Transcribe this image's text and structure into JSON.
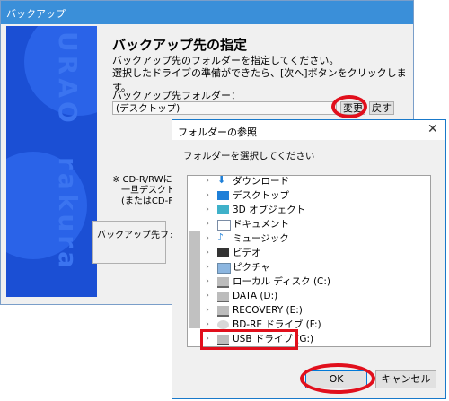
{
  "backup_window": {
    "title": "バックアップ",
    "heading": "バックアップ先の指定",
    "desc_line1": "バックアップ先のフォルダーを指定してください。",
    "desc_line2": "選択したドライブの準備ができたら、[次へ]ボタンをクリックします。",
    "folder_label": "バックアップ先フォルダー：",
    "folder_value": "(デスクトップ)",
    "change_button": "変更",
    "back_button": "戻す",
    "note_line1": "※ CD-R/RWに",
    "note_line2": "一旦デスクト",
    "note_line3": "(またはCD-F",
    "groupbox_text": "バックアップ先フォル",
    "sidebar_brand_vertical": "URAO",
    "sidebar_brand_vertical2": "rakura",
    "accent_color": "#1b4fd4"
  },
  "browse_dialog": {
    "title": "フォルダーの参照",
    "instruction": "フォルダーを選択してください",
    "tree_items": [
      {
        "label": "ダウンロード",
        "icon": "download-icon"
      },
      {
        "label": "デスクトップ",
        "icon": "desktop-icon"
      },
      {
        "label": "3D オブジェクト",
        "icon": "3d-objects-icon"
      },
      {
        "label": "ドキュメント",
        "icon": "documents-icon"
      },
      {
        "label": "ミュージック",
        "icon": "music-icon"
      },
      {
        "label": "ビデオ",
        "icon": "video-icon"
      },
      {
        "label": "ピクチャ",
        "icon": "pictures-icon"
      },
      {
        "label": "ローカル ディスク (C:)",
        "icon": "drive-icon"
      },
      {
        "label": "DATA (D:)",
        "icon": "drive-icon"
      },
      {
        "label": "RECOVERY (E:)",
        "icon": "drive-icon"
      },
      {
        "label": "BD-RE ドライブ (F:)",
        "icon": "optical-drive-icon"
      },
      {
        "label": "USB ドライブ (G:)",
        "icon": "usb-drive-icon"
      }
    ],
    "ok_button": "OK",
    "cancel_button": "キャンセル",
    "highlight_color": "#e10f1c"
  }
}
